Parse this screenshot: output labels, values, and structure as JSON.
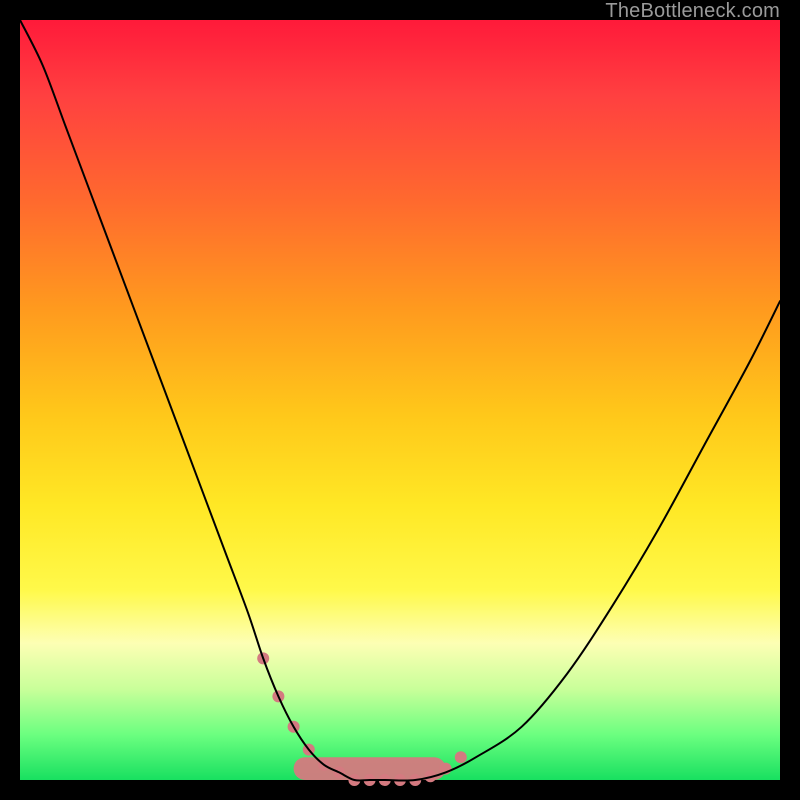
{
  "attribution": "TheBottleneck.com",
  "chart_data": {
    "type": "line",
    "title": "",
    "xlabel": "",
    "ylabel": "",
    "x_range": [
      0,
      100
    ],
    "y_range": [
      0,
      100
    ],
    "series": [
      {
        "name": "bottleneck-curve",
        "stroke": "#000000",
        "stroke_width": 2,
        "x": [
          0,
          3,
          6,
          9,
          12,
          15,
          18,
          21,
          24,
          27,
          30,
          32,
          34,
          36,
          38,
          40,
          42,
          44,
          46,
          48,
          52,
          56,
          60,
          66,
          72,
          78,
          84,
          90,
          96,
          100
        ],
        "values": [
          100,
          94,
          86,
          78,
          70,
          62,
          54,
          46,
          38,
          30,
          22,
          16,
          11,
          7,
          4,
          2,
          1,
          0,
          0,
          0,
          0,
          1,
          3,
          7,
          14,
          23,
          33,
          44,
          55,
          63
        ]
      }
    ],
    "markers": {
      "name": "trough-markers",
      "fill": "#d47a80",
      "r": 6,
      "x": [
        32,
        34,
        36,
        38,
        40,
        42,
        44,
        46,
        48,
        50,
        52,
        54,
        56,
        58
      ],
      "values": [
        16,
        11,
        7,
        4,
        2,
        1,
        0,
        0,
        0,
        0,
        0,
        0.5,
        1.5,
        3
      ]
    },
    "trough_band": {
      "name": "trough-band",
      "fill": "#d47a80",
      "opacity": 0.95,
      "x_start": 36,
      "x_end": 56,
      "y": 0,
      "height": 3
    }
  }
}
